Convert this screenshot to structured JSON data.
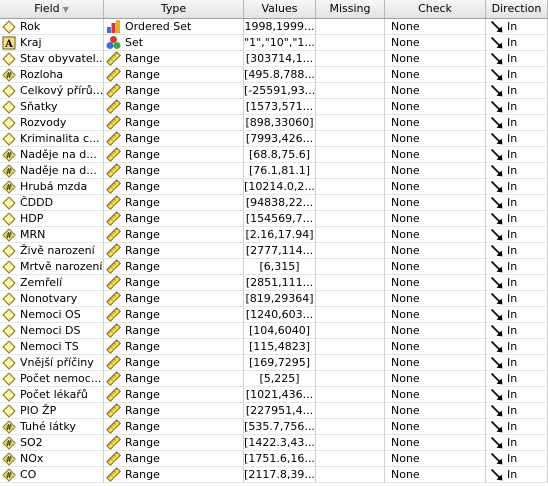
{
  "columns": {
    "field": "Field",
    "type": "Type",
    "values": "Values",
    "missing": "Missing",
    "check": "Check",
    "direction": "Direction"
  },
  "rows": [
    {
      "field": "Rok",
      "field_icon": "diamond-icon",
      "type": "Ordered Set",
      "type_icon": "ordered-set-icon",
      "values": "1998,1999...",
      "missing": "",
      "check": "None",
      "direction": "In"
    },
    {
      "field": "Kraj",
      "field_icon": "string-a-icon",
      "type": "Set",
      "type_icon": "set-icon",
      "values": "\"1\",\"10\",\"1...",
      "missing": "",
      "check": "None",
      "direction": "In"
    },
    {
      "field": "Stav obyvatel...",
      "field_icon": "diamond-icon",
      "type": "Range",
      "type_icon": "ruler-icon",
      "values": "[303714,1...",
      "missing": "",
      "check": "None",
      "direction": "In"
    },
    {
      "field": "Rozloha",
      "field_icon": "hash-icon",
      "type": "Range",
      "type_icon": "ruler-icon",
      "values": "[495.8,788...",
      "missing": "",
      "check": "None",
      "direction": "In"
    },
    {
      "field": "Celkový přírů...",
      "field_icon": "diamond-icon",
      "type": "Range",
      "type_icon": "ruler-icon",
      "values": "[-25591,93...",
      "missing": "",
      "check": "None",
      "direction": "In"
    },
    {
      "field": "Sňatky",
      "field_icon": "diamond-icon",
      "type": "Range",
      "type_icon": "ruler-icon",
      "values": "[1573,571...",
      "missing": "",
      "check": "None",
      "direction": "In"
    },
    {
      "field": "Rozvody",
      "field_icon": "diamond-icon",
      "type": "Range",
      "type_icon": "ruler-icon",
      "values": "[898,33060]",
      "missing": "",
      "check": "None",
      "direction": "In"
    },
    {
      "field": "Kriminalita c...",
      "field_icon": "diamond-icon",
      "type": "Range",
      "type_icon": "ruler-icon",
      "values": "[7993,426...",
      "missing": "",
      "check": "None",
      "direction": "In"
    },
    {
      "field": "Naděje na d...",
      "field_icon": "hash-icon",
      "type": "Range",
      "type_icon": "ruler-icon",
      "values": "[68.8,75.6]",
      "missing": "",
      "check": "None",
      "direction": "In"
    },
    {
      "field": "Naděje na d...",
      "field_icon": "hash-icon",
      "type": "Range",
      "type_icon": "ruler-icon",
      "values": "[76.1,81.1]",
      "missing": "",
      "check": "None",
      "direction": "In"
    },
    {
      "field": "Hrubá mzda",
      "field_icon": "hash-icon",
      "type": "Range",
      "type_icon": "ruler-icon",
      "values": "[10214.0,2...",
      "missing": "",
      "check": "None",
      "direction": "In"
    },
    {
      "field": "ČDDD",
      "field_icon": "diamond-icon",
      "type": "Range",
      "type_icon": "ruler-icon",
      "values": "[94838,22...",
      "missing": "",
      "check": "None",
      "direction": "In"
    },
    {
      "field": "HDP",
      "field_icon": "diamond-icon",
      "type": "Range",
      "type_icon": "ruler-icon",
      "values": "[154569,7...",
      "missing": "",
      "check": "None",
      "direction": "In"
    },
    {
      "field": "MRN",
      "field_icon": "hash-icon",
      "type": "Range",
      "type_icon": "ruler-icon",
      "values": "[2.16,17.94]",
      "missing": "",
      "check": "None",
      "direction": "In"
    },
    {
      "field": "Živě narození",
      "field_icon": "diamond-icon",
      "type": "Range",
      "type_icon": "ruler-icon",
      "values": "[2777,114...",
      "missing": "",
      "check": "None",
      "direction": "In"
    },
    {
      "field": "Mrtvě narození",
      "field_icon": "diamond-icon",
      "type": "Range",
      "type_icon": "ruler-icon",
      "values": "[6,315]",
      "missing": "",
      "check": "None",
      "direction": "In"
    },
    {
      "field": "Zemřelí",
      "field_icon": "diamond-icon",
      "type": "Range",
      "type_icon": "ruler-icon",
      "values": "[2851,111...",
      "missing": "",
      "check": "None",
      "direction": "In"
    },
    {
      "field": "Nonotvary",
      "field_icon": "diamond-icon",
      "type": "Range",
      "type_icon": "ruler-icon",
      "values": "[819,29364]",
      "missing": "",
      "check": "None",
      "direction": "In"
    },
    {
      "field": "Nemoci OS",
      "field_icon": "diamond-icon",
      "type": "Range",
      "type_icon": "ruler-icon",
      "values": "[1240,603...",
      "missing": "",
      "check": "None",
      "direction": "In"
    },
    {
      "field": "Nemoci DS",
      "field_icon": "diamond-icon",
      "type": "Range",
      "type_icon": "ruler-icon",
      "values": "[104,6040]",
      "missing": "",
      "check": "None",
      "direction": "In"
    },
    {
      "field": "Nemoci TS",
      "field_icon": "diamond-icon",
      "type": "Range",
      "type_icon": "ruler-icon",
      "values": "[115,4823]",
      "missing": "",
      "check": "None",
      "direction": "In"
    },
    {
      "field": "Vnější příčiny",
      "field_icon": "diamond-icon",
      "type": "Range",
      "type_icon": "ruler-icon",
      "values": "[169,7295]",
      "missing": "",
      "check": "None",
      "direction": "In"
    },
    {
      "field": "Počet nemoc...",
      "field_icon": "diamond-icon",
      "type": "Range",
      "type_icon": "ruler-icon",
      "values": "[5,225]",
      "missing": "",
      "check": "None",
      "direction": "In"
    },
    {
      "field": "Počet lékařů",
      "field_icon": "diamond-icon",
      "type": "Range",
      "type_icon": "ruler-icon",
      "values": "[1021,436...",
      "missing": "",
      "check": "None",
      "direction": "In"
    },
    {
      "field": "PIO ŽP",
      "field_icon": "diamond-icon",
      "type": "Range",
      "type_icon": "ruler-icon",
      "values": "[227951,4...",
      "missing": "",
      "check": "None",
      "direction": "In"
    },
    {
      "field": "Tuhé látky",
      "field_icon": "hash-icon",
      "type": "Range",
      "type_icon": "ruler-icon",
      "values": "[535.7,756...",
      "missing": "",
      "check": "None",
      "direction": "In"
    },
    {
      "field": "SO2",
      "field_icon": "hash-icon",
      "type": "Range",
      "type_icon": "ruler-icon",
      "values": "[1422.3,43...",
      "missing": "",
      "check": "None",
      "direction": "In"
    },
    {
      "field": "NOx",
      "field_icon": "hash-icon",
      "type": "Range",
      "type_icon": "ruler-icon",
      "values": "[1751.6,16...",
      "missing": "",
      "check": "None",
      "direction": "In"
    },
    {
      "field": "CO",
      "field_icon": "hash-icon",
      "type": "Range",
      "type_icon": "ruler-icon",
      "values": "[2117.8,39...",
      "missing": "",
      "check": "None",
      "direction": "In"
    }
  ]
}
